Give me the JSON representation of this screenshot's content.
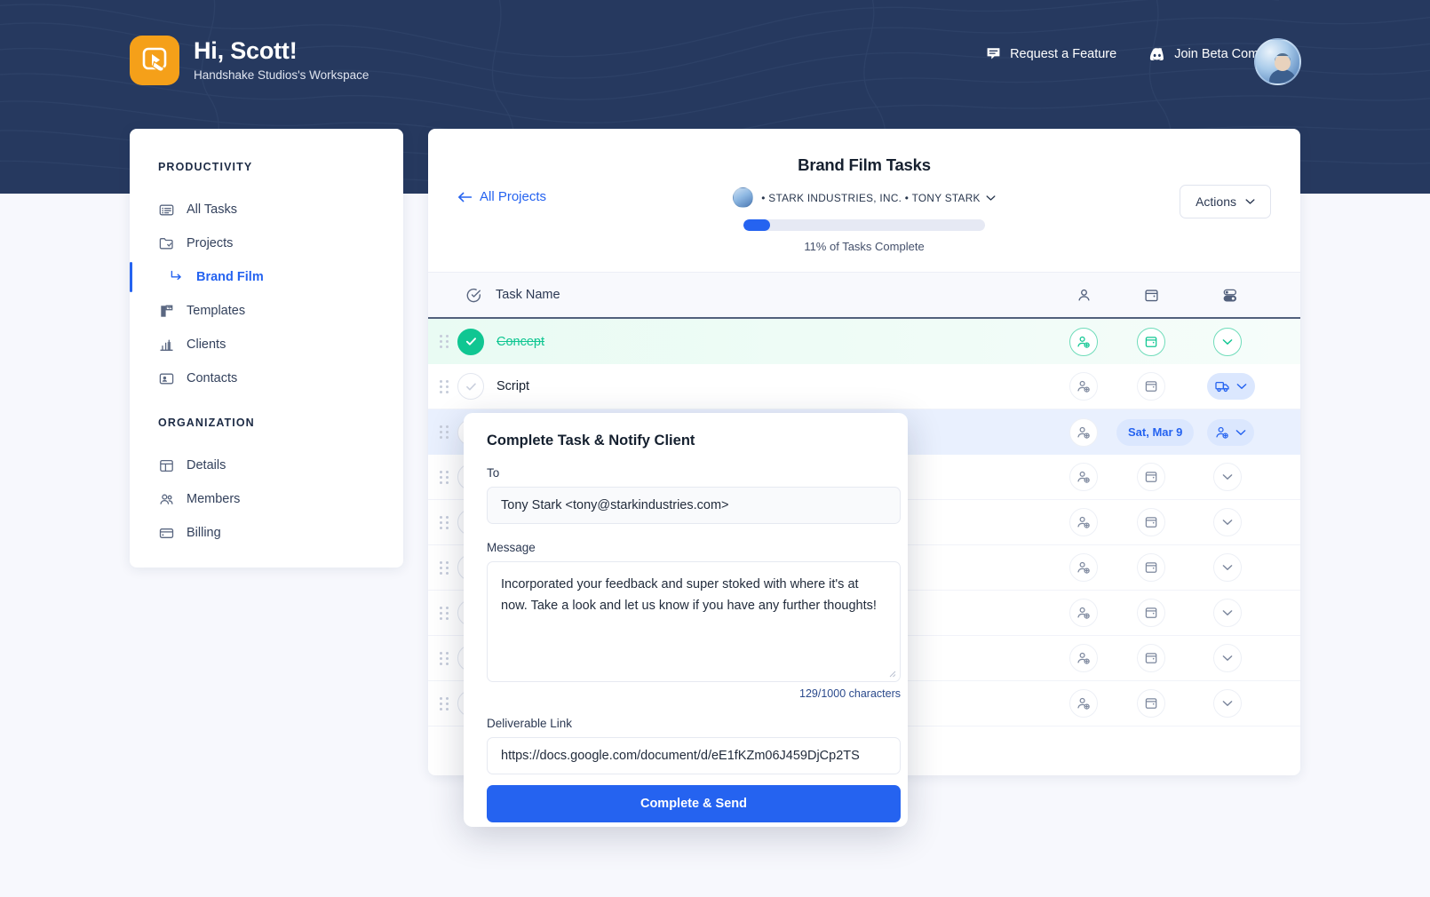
{
  "header": {
    "greeting": "Hi, Scott!",
    "workspace": "Handshake Studios's Workspace",
    "logo_icon": "play-cursor-logo-icon",
    "nav": [
      {
        "label": "Request a Feature",
        "icon": "speech-bubble-icon"
      },
      {
        "label": "Join Beta Community",
        "icon": "discord-icon"
      }
    ],
    "avatar_icon": "user-avatar"
  },
  "sidebar": {
    "groups": [
      {
        "title": "PRODUCTIVITY",
        "items": [
          {
            "label": "All Tasks",
            "icon": "list-card-icon",
            "active": false
          },
          {
            "label": "Projects",
            "icon": "folder-check-icon",
            "active": false
          },
          {
            "label": "Templates",
            "icon": "ruler-icon",
            "active": false
          },
          {
            "label": "Clients",
            "icon": "bar-chart-icon",
            "active": false
          },
          {
            "label": "Contacts",
            "icon": "contact-card-icon",
            "active": false
          }
        ],
        "sub_item": {
          "label": "Brand Film",
          "icon": "arrow-branch-icon",
          "active": true
        }
      },
      {
        "title": "ORGANIZATION",
        "items": [
          {
            "label": "Details",
            "icon": "layout-icon",
            "active": false
          },
          {
            "label": "Members",
            "icon": "people-icon",
            "active": false
          },
          {
            "label": "Billing",
            "icon": "credit-card-icon",
            "active": false
          }
        ]
      }
    ]
  },
  "main": {
    "back_label": "All Projects",
    "back_icon": "arrow-left-icon",
    "project_title": "Brand Film Tasks",
    "client_meta": "• STARK INDUSTRIES, INC. • TONY STARK",
    "client_meta_chevron": "chevron-down-icon",
    "progress_percent": 11,
    "progress_label": "11% of Tasks Complete",
    "actions_label": "Actions",
    "actions_chevron": "chevron-down-icon",
    "table": {
      "columns": [
        {
          "label": "",
          "icon": "check-circle-icon"
        },
        {
          "label": "Task Name",
          "icon": ""
        },
        {
          "label": "",
          "icon": "person-icon"
        },
        {
          "label": "",
          "icon": "calendar-icon"
        },
        {
          "label": "",
          "icon": "toggles-icon"
        }
      ],
      "rows": [
        {
          "name": "Concept",
          "state": "done",
          "assignee_icon": "person-add-icon",
          "date": "",
          "date_icon": "calendar-icon",
          "status_icon": "chevron-down-icon"
        },
        {
          "name": "Script",
          "state": "normal",
          "assignee_icon": "person-add-icon",
          "date": "",
          "date_icon": "calendar-icon",
          "status_icon": "truck-icon"
        },
        {
          "name": "",
          "state": "selected",
          "assignee_icon": "person-add-icon",
          "date": "Sat, Mar 9",
          "date_icon": "",
          "status_icon": "person-add-icon"
        },
        {
          "name": "",
          "state": "normal",
          "assignee_icon": "person-add-icon",
          "date": "",
          "date_icon": "calendar-icon",
          "status_icon": "chevron-down-icon"
        },
        {
          "name": "",
          "state": "normal",
          "assignee_icon": "person-add-icon",
          "date": "",
          "date_icon": "calendar-icon",
          "status_icon": "chevron-down-icon"
        },
        {
          "name": "",
          "state": "normal",
          "assignee_icon": "person-add-icon",
          "date": "",
          "date_icon": "calendar-icon",
          "status_icon": "chevron-down-icon"
        },
        {
          "name": "",
          "state": "normal",
          "assignee_icon": "person-add-icon",
          "date": "",
          "date_icon": "calendar-icon",
          "status_icon": "chevron-down-icon"
        },
        {
          "name": "",
          "state": "normal",
          "assignee_icon": "person-add-icon",
          "date": "",
          "date_icon": "calendar-icon",
          "status_icon": "chevron-down-icon"
        },
        {
          "name": "",
          "state": "normal",
          "assignee_icon": "person-add-icon",
          "date": "",
          "date_icon": "calendar-icon",
          "status_icon": "chevron-down-icon"
        }
      ]
    }
  },
  "modal": {
    "title": "Complete Task & Notify Client",
    "to_label": "To",
    "to_value": "Tony Stark <tony@starkindustries.com>",
    "message_label": "Message",
    "message_value": "Incorporated your feedback and super stoked with where it's at now. Take a look and let us know if you have any further thoughts!",
    "counter": "129/1000 characters",
    "link_label": "Deliverable Link",
    "link_value": "https://docs.google.com/document/d/eE1fKZm06J459DjCp2TS",
    "submit_label": "Complete & Send"
  },
  "colors": {
    "navy": "#26395f",
    "accent_blue": "#2563f0",
    "green": "#10c692",
    "orange": "#f5a019",
    "page_bg": "#f7f8fd",
    "pill_bg": "#dbe7fe"
  }
}
